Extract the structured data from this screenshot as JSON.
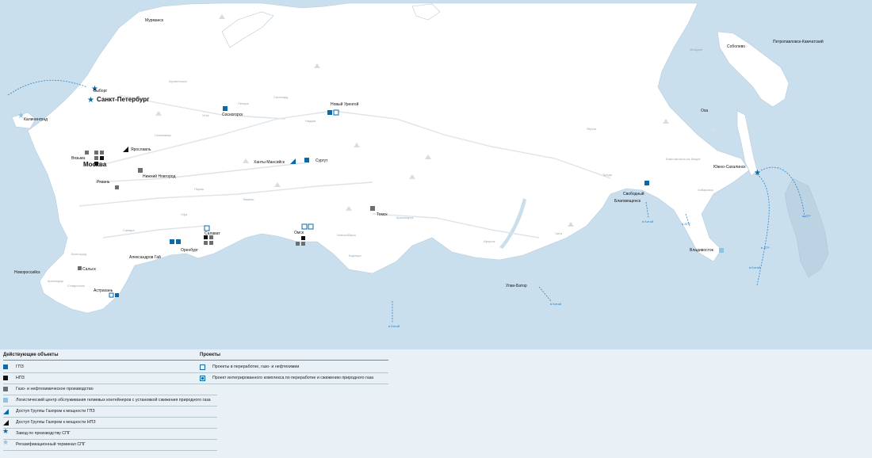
{
  "map": {
    "cities": [
      {
        "name": "Мурманск"
      },
      {
        "name": "Выборг"
      },
      {
        "name": "Санкт-Петербург",
        "major": true
      },
      {
        "name": "Калининград"
      },
      {
        "name": "Сосногорск"
      },
      {
        "name": "Новый Уренгой"
      },
      {
        "name": "Ярославль"
      },
      {
        "name": "Москва",
        "major": true
      },
      {
        "name": "Вязьма"
      },
      {
        "name": "Нижний Новгород"
      },
      {
        "name": "Ханты-Мансийск"
      },
      {
        "name": "Сургут"
      },
      {
        "name": "Рязань"
      },
      {
        "name": "Томск"
      },
      {
        "name": "Салават"
      },
      {
        "name": "Оренбург"
      },
      {
        "name": "Омск"
      },
      {
        "name": "Александров Гай"
      },
      {
        "name": "Новороссийск"
      },
      {
        "name": "Сальск"
      },
      {
        "name": "Астрахань"
      },
      {
        "name": "Соболево"
      },
      {
        "name": "Петропавловск-Камчатский"
      },
      {
        "name": "Оха"
      },
      {
        "name": "Южно-Сахалинск"
      },
      {
        "name": "Свободный"
      },
      {
        "name": "Благовещенск"
      },
      {
        "name": "Владивосток"
      },
      {
        "name": "Улан-Батор"
      }
    ],
    "gray_labels": [
      "Архангельск",
      "Ухта",
      "Печора",
      "Салехард",
      "Надым",
      "Сыктывкар",
      "Пермь",
      "Уфа",
      "Тюмень",
      "Новосибирск",
      "Красноярск",
      "Иркутск",
      "Чита",
      "Якутск",
      "Хабаровск",
      "Тында",
      "Барнаул",
      "Самара",
      "Волгоград",
      "Краснодар",
      "Ставрополь",
      "Магадан",
      "Комсомольск-на-Амуре"
    ],
    "route_labels": [
      "в Китай",
      "в АТР",
      "в Китай",
      "в Китай",
      "в АТР",
      "в Китай",
      "в АТР"
    ]
  },
  "legend": {
    "operating": {
      "title": "Действующие объекты",
      "items": [
        {
          "label": "ГПЗ",
          "icon": "gpz-square-icon"
        },
        {
          "label": "НПЗ",
          "icon": "npz-square-icon"
        },
        {
          "label": "Газо- и нефтехимическое производство",
          "icon": "petrochem-square-icon"
        },
        {
          "label": "Логистический центр обслуживания гелиевых контейнеров с установкой сжижения природного газа",
          "icon": "logistics-square-icon"
        },
        {
          "label": "Доступ Группы Газпром к мощности ГПЗ",
          "icon": "gpz-access-triangle-icon"
        },
        {
          "label": "Доступ Группы Газпром к мощности НПЗ",
          "icon": "npz-access-triangle-icon"
        },
        {
          "label": "Завод по производству СПГ",
          "icon": "lng-plant-star-icon"
        },
        {
          "label": "Регазификационный терминал СПГ",
          "icon": "regas-terminal-star-icon"
        }
      ]
    },
    "projects": {
      "title": "Проекты",
      "items": [
        {
          "label": "Проекты в переработке, газо- и нефтехимии",
          "icon": "project-outline-square-icon"
        },
        {
          "label": "Проект интегрированного комплекса по переработке и сжижению природного газа",
          "icon": "integrated-complex-icon"
        }
      ]
    },
    "colors": {
      "gpz": "#0a6aa8",
      "npz": "#111111",
      "petrochem": "#6e6e6e",
      "logistics": "#8fc3df",
      "sea": "#c9dfee",
      "land": "#ffffff",
      "route": "#2f82c4"
    }
  }
}
